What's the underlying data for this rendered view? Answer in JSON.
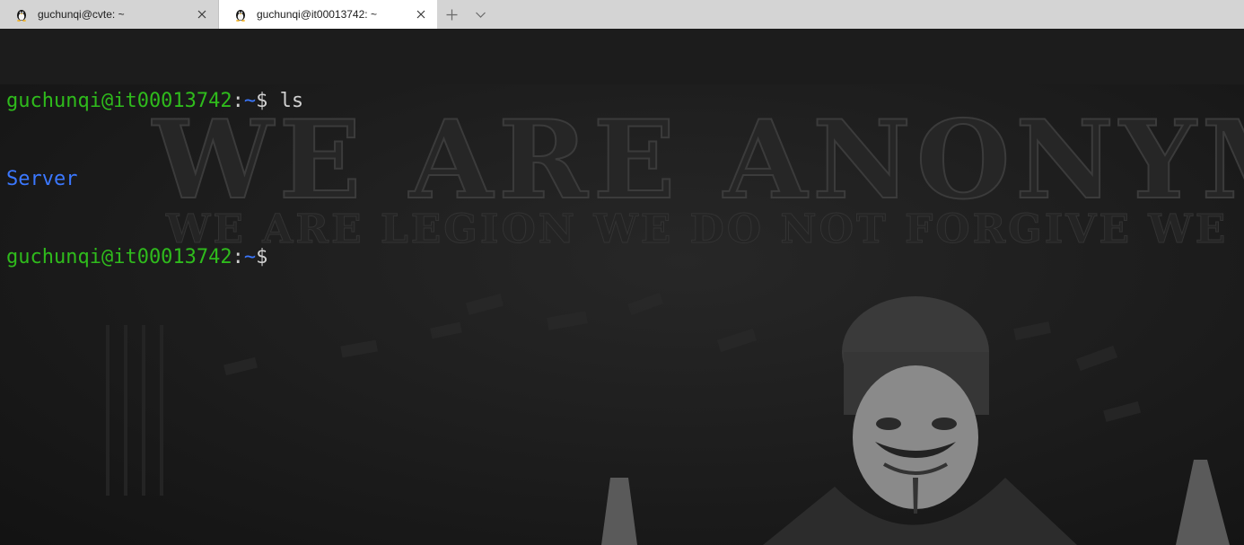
{
  "tabs": [
    {
      "title": "guchunqi@cvte: ~",
      "icon": "linux-penguin-icon",
      "active": false
    },
    {
      "title": "guchunqi@it00013742: ~",
      "icon": "linux-penguin-icon",
      "active": true
    }
  ],
  "tabbar": {
    "new_tab_icon": "plus-icon",
    "dropdown_icon": "chevron-down-icon"
  },
  "terminal": {
    "line1": {
      "user_host": "guchunqi@it00013742",
      "sep": ":",
      "path": "~",
      "prompt": "$ ",
      "command": "ls"
    },
    "line2": {
      "output": "Server"
    },
    "line3": {
      "user_host": "guchunqi@it00013742",
      "sep": ":",
      "path": "~",
      "prompt": "$"
    }
  },
  "background": {
    "headline": "WE ARE ANONYMOUS",
    "subline": "WE ARE LEGION WE DO NOT FORGIVE WE DO NOT FORGET"
  },
  "colors": {
    "prompt_user": "#2fbb1c",
    "prompt_path": "#3b78ff",
    "directory": "#3b78ff",
    "text": "#d0d0d0",
    "terminal_bg": "#1b1b1b"
  }
}
